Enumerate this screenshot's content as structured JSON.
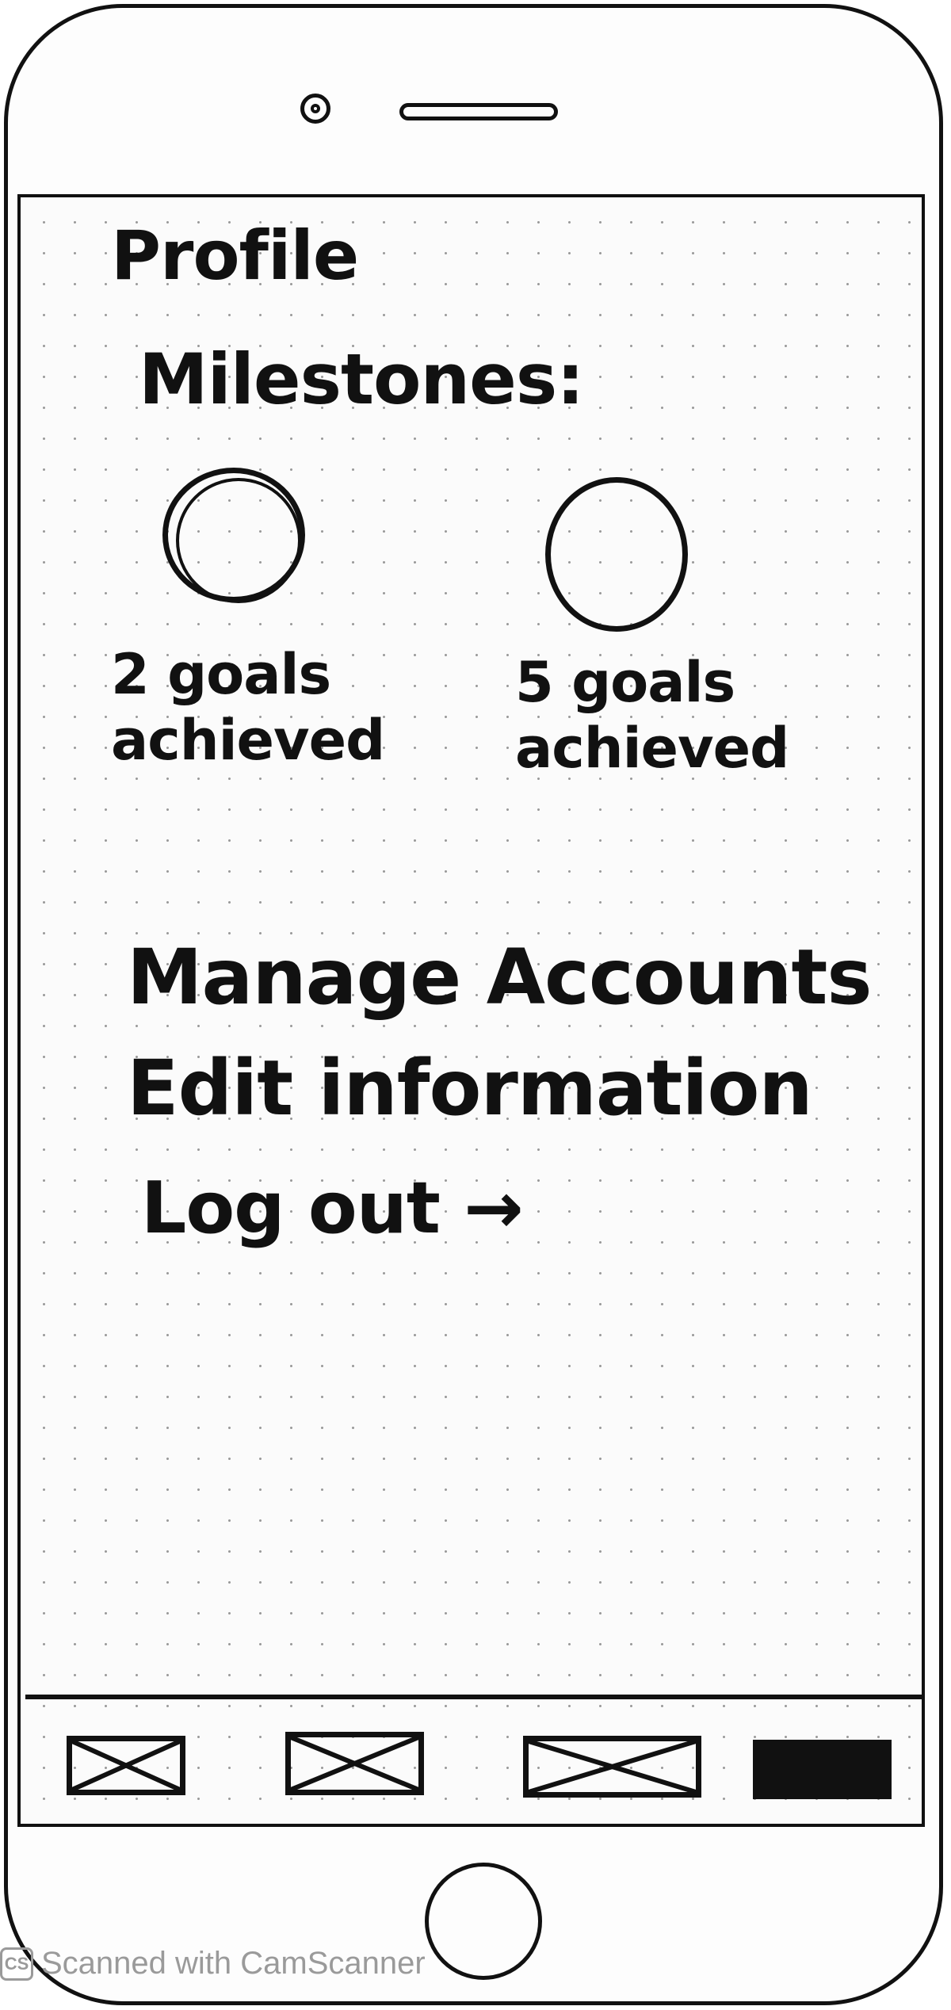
{
  "header": {
    "title": "Profile"
  },
  "milestones": {
    "label": "Milestones:",
    "items": [
      {
        "line1": "2 goals",
        "line2": "achieved"
      },
      {
        "line1": "5 goals",
        "line2": "achieved"
      }
    ]
  },
  "menu": {
    "items": [
      {
        "label": "Manage Accounts"
      },
      {
        "label": "Edit information"
      },
      {
        "label": "Log out →"
      }
    ]
  },
  "tab_bar": {
    "tabs": [
      {
        "icon": "placeholder-image-icon",
        "active": false
      },
      {
        "icon": "placeholder-image-icon",
        "active": false
      },
      {
        "icon": "placeholder-image-icon",
        "active": false
      },
      {
        "icon": "placeholder-image-icon",
        "active": true
      }
    ]
  },
  "watermark": {
    "logo": "CS",
    "text": "Scanned with CamScanner"
  }
}
